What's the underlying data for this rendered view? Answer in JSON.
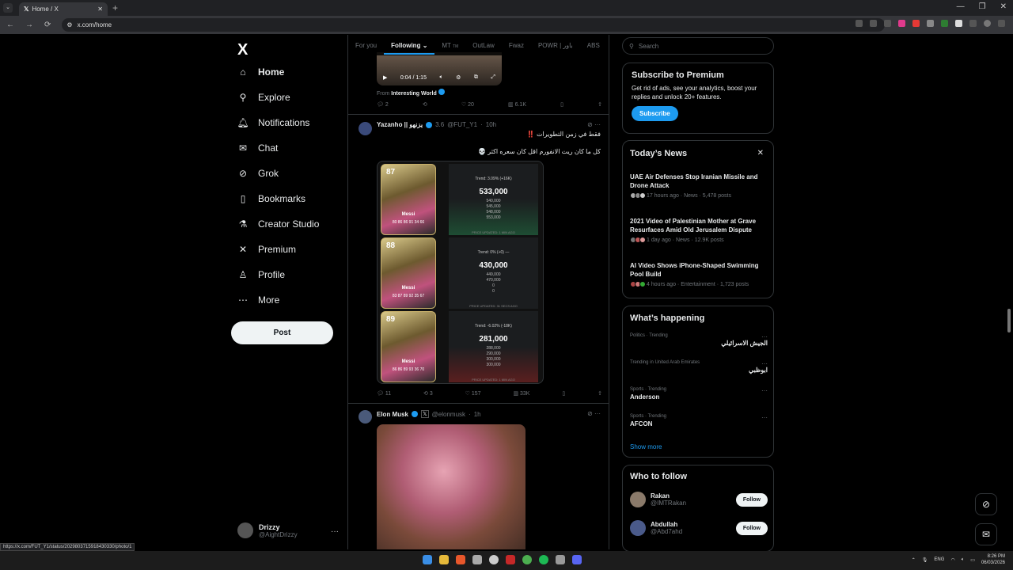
{
  "browser": {
    "tab_title": "Home / X",
    "url": "x.com/home",
    "status_url": "https://x.com/FUT_Y1/status/2029803715918430330/photo/1"
  },
  "nav": {
    "logo": "X",
    "items": [
      {
        "label": "Home",
        "icon": "home-icon"
      },
      {
        "label": "Explore",
        "icon": "search-icon"
      },
      {
        "label": "Notifications",
        "icon": "bell-icon"
      },
      {
        "label": "Chat",
        "icon": "mail-icon"
      },
      {
        "label": "Grok",
        "icon": "grok-icon"
      },
      {
        "label": "Bookmarks",
        "icon": "bookmark-icon"
      },
      {
        "label": "Creator Studio",
        "icon": "flask-icon"
      },
      {
        "label": "Premium",
        "icon": "x-icon"
      },
      {
        "label": "Profile",
        "icon": "person-icon"
      },
      {
        "label": "More",
        "icon": "more-circle-icon"
      }
    ],
    "post_label": "Post",
    "account": {
      "name": "Drizzy",
      "handle": "@AightDrizzy",
      "more": "···"
    }
  },
  "feed": {
    "tabs": [
      "For you",
      "Following",
      "MT",
      "OutLaw",
      "Fwaz",
      "POWR | باور",
      "ABS"
    ],
    "tab_mt_badge": "TM",
    "video": {
      "time": "0:04 / 1:15",
      "from_prefix": "From",
      "from_name": "Interesting World"
    },
    "post1_stats": {
      "replies": "2",
      "likes": "20",
      "views": "6.1K"
    },
    "post2": {
      "name": "Yazanho || يزنهو",
      "tag": "3.6",
      "handle": "@FUT_Y1",
      "time": "10h",
      "line1": "فقط في زمن التطويرات ‼️",
      "line2": "كل ما كان ريت الانفورم اقل كان سعره اكثر 💀",
      "cards": [
        {
          "rating": "87",
          "pos": "ST",
          "name": "Messi",
          "stats": "80 86 86 91 34 66",
          "trend": "Trend: 3.09% (+16K)",
          "price": "533,000",
          "list": [
            "540,000",
            "545,000",
            "548,000",
            "553,000"
          ],
          "updated": "PRICE UPDATED: 1 MIN AGO"
        },
        {
          "rating": "88",
          "pos": "ST",
          "name": "Messi",
          "stats": "83 87 89 92 35 67",
          "trend": "Trend: 0% (+0) —",
          "price": "430,000",
          "list": [
            "449,000",
            "470,000",
            "0",
            "0"
          ],
          "updated": "PRICE UPDATED: 31 SECS AGO"
        },
        {
          "rating": "89",
          "pos": "CAM",
          "name": "Messi",
          "stats": "86 86 89 93 36 70",
          "trend": "Trend: -6.02% (-18K)",
          "price": "281,000",
          "list": [
            "288,000",
            "290,000",
            "300,000",
            "300,000"
          ],
          "updated": "PRICE UPDATED: 1 MIN AGO"
        }
      ],
      "stats": {
        "replies": "11",
        "reposts": "3",
        "likes": "157",
        "views": "33K"
      }
    },
    "post3": {
      "name": "Elon Musk",
      "handle": "@elonmusk",
      "time": "1h"
    }
  },
  "right": {
    "search_placeholder": "Search",
    "premium": {
      "title": "Subscribe to Premium",
      "body": "Get rid of ads, see your analytics, boost your replies and unlock 20+ features.",
      "button": "Subscribe"
    },
    "news": {
      "title": "Today’s News",
      "close": "✕",
      "items": [
        {
          "headline": "UAE Air Defenses Stop Iranian Missile and Drone Attack",
          "meta": "17 hours ago · News · 5,478 posts"
        },
        {
          "headline": "2021 Video of Palestinian Mother at Grave Resurfaces Amid Old Jerusalem Dispute",
          "meta": "1 day ago · News · 12.9K posts"
        },
        {
          "headline": "AI Video Shows iPhone-Shaped Swimming Pool Build",
          "meta": "4 hours ago · Entertainment · 1,723 posts"
        }
      ]
    },
    "happening": {
      "title": "What’s happening",
      "items": [
        {
          "context": "Politics · Trending",
          "topic": "الجيش الاسرائيلي"
        },
        {
          "context": "Trending in United Arab Emirates",
          "topic": "ابوظبي"
        },
        {
          "context": "Sports · Trending",
          "topic": "Anderson"
        },
        {
          "context": "Sports · Trending",
          "topic": "AFCON"
        }
      ],
      "show_more": "Show more"
    },
    "follow": {
      "title": "Who to follow",
      "items": [
        {
          "name": "Rakan",
          "handle": "@IMTRakan",
          "button": "Follow"
        },
        {
          "name": "Abdullah",
          "handle": "@Abd7ahd",
          "button": "Follow"
        }
      ]
    }
  },
  "taskbar": {
    "lang": "ENG",
    "time": "8:26 PM",
    "date": "06/03/2026"
  },
  "colors": {
    "accent": "#1d9bf0",
    "background": "#000000",
    "text": "#e7e9ea",
    "muted": "#71767b"
  }
}
